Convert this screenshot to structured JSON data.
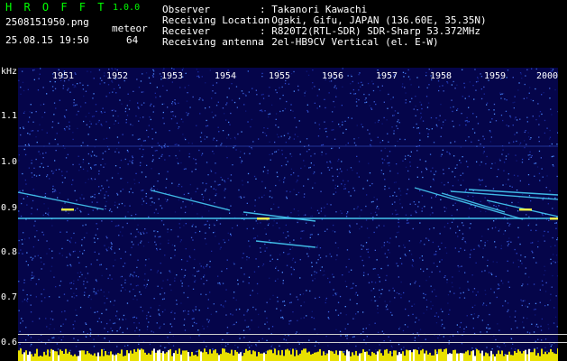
{
  "app": {
    "name": "H R O F F T",
    "version": "1.0.0"
  },
  "file": {
    "name": "2508151950.png",
    "timestamp": "25.08.15 19:50"
  },
  "meteor": {
    "label": "meteor",
    "count": "64"
  },
  "info": [
    {
      "label": "Observer",
      "value": ": Takanori Kawachi"
    },
    {
      "label": "Receiving Location",
      "value": ": Ogaki, Gifu, JAPAN (136.60E, 35.35N)"
    },
    {
      "label": "Receiver",
      "value": ": R820T2(RTL-SDR) SDR-Sharp 53.372MHz"
    },
    {
      "label": "Receiving antenna",
      "value": ": 2el-HB9CV Vertical (el. E-W)"
    }
  ],
  "chart_data": {
    "type": "heatmap",
    "ylabel": "kHz",
    "yticks": [
      "1.1",
      "1.0",
      "0.9",
      "0.8",
      "0.7",
      "0.6"
    ],
    "xticks": [
      "1951",
      "1952",
      "1953",
      "1954",
      "1955",
      "1956",
      "1957",
      "1958",
      "1959",
      "2000"
    ],
    "ylim": [
      0.58,
      1.18
    ],
    "colors": {
      "background": "#05054a",
      "trace": "#4ad8ff",
      "hot": "#ffff40",
      "text": "#ffffff",
      "title": "#00ff00"
    }
  }
}
